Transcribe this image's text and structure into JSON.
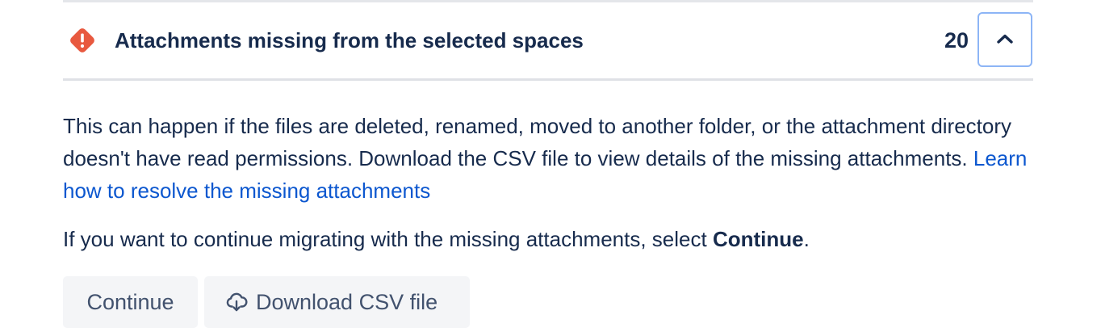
{
  "section": {
    "title": "Attachments missing from the selected spaces",
    "count": "20",
    "status_icon": "warning-diamond-icon",
    "toggle_icon": "chevron-up-icon",
    "colors": {
      "warning": "#E8593F",
      "link": "#0C57CF",
      "text": "#172B4D",
      "focus_border": "#8DB5F6",
      "button_bg": "#F4F5F7"
    }
  },
  "description": {
    "text": "This can happen if the files are deleted, renamed, moved to another folder, or the attachment directory doesn't have read permissions. Download the CSV file to view details of the missing attachments. ",
    "link_text": "Learn how to resolve the missing attachments"
  },
  "instruction": {
    "prefix": "If you want to continue migrating with the missing attachments, select ",
    "emphasis": "Continue",
    "suffix": "."
  },
  "actions": {
    "continue_label": "Continue",
    "download_label": "Download CSV file",
    "download_icon": "cloud-download-icon"
  }
}
